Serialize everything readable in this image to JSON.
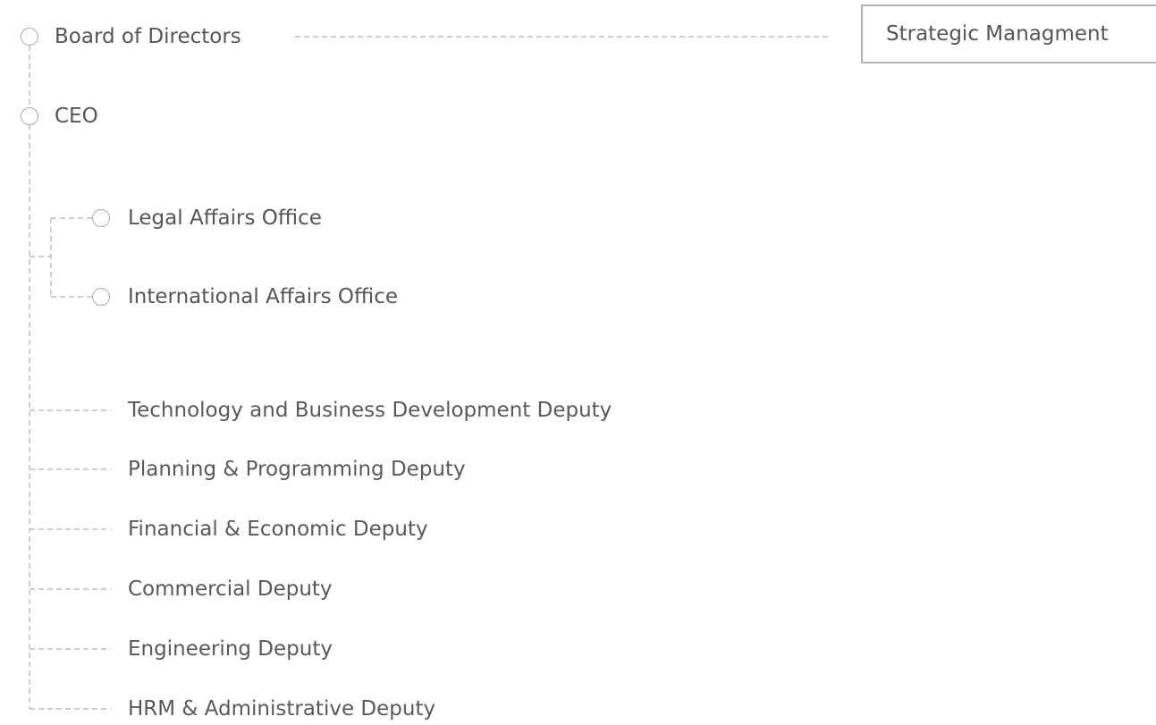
{
  "top": {
    "board_label": "Board of Directors",
    "ceo_label": "CEO",
    "strategic_box_label": "Strategic Managment"
  },
  "offices": [
    {
      "label": "Legal Affairs Office"
    },
    {
      "label": "International Affairs Office"
    }
  ],
  "deputies": [
    {
      "label": "Technology and Business Development Deputy"
    },
    {
      "label": "Planning & Programming Deputy"
    },
    {
      "label": "Financial & Economic Deputy"
    },
    {
      "label": "Commercial Deputy"
    },
    {
      "label": "Engineering Deputy"
    },
    {
      "label": "HRM & Administrative Deputy"
    }
  ],
  "colors": {
    "connector": "#bdbdbd",
    "node_border": "#a9a9a9",
    "text": "#555555"
  }
}
